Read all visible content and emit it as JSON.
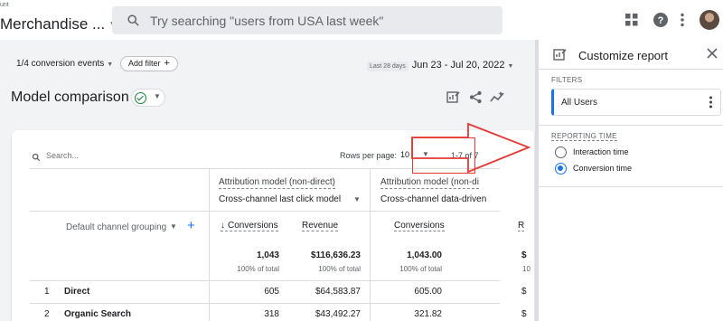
{
  "header": {
    "account_text": "unt",
    "property_name": "Merchandise ...",
    "search_placeholder": "Try searching \"users from USA last week\""
  },
  "toolbar": {
    "conversion_events": "1/4 conversion events",
    "add_filter": "Add filter",
    "date_badge": "Last 28 days",
    "date_range": "Jun 23 - Jul 20, 2022"
  },
  "report": {
    "title": "Model comparison"
  },
  "table": {
    "search_placeholder": "Search...",
    "rows_per_page_label": "Rows per page:",
    "rows_per_page_value": "10",
    "pager_text": "1-7 of 7",
    "dimension_label": "Default channel grouping",
    "models": [
      {
        "attribution_label": "Attribution model (non-direct)",
        "model": "Cross-channel last click model"
      },
      {
        "attribution_label": "Attribution model (non-di",
        "model": "Cross-channel data-driven"
      }
    ],
    "metric_headers": [
      "Conversions",
      "Revenue",
      "Conversions",
      "R"
    ],
    "totals": {
      "values": [
        "1,043",
        "$116,636.23",
        "1,043.00",
        "$"
      ],
      "percents": [
        "100% of total",
        "100% of total",
        "100% of total",
        "10"
      ]
    },
    "rows": [
      {
        "index": "1",
        "channel": "Direct",
        "values": [
          "605",
          "$64,583.87",
          "605.00",
          "$"
        ]
      },
      {
        "index": "2",
        "channel": "Organic Search",
        "values": [
          "318",
          "$43,492.27",
          "321.82",
          "$"
        ]
      }
    ]
  },
  "panel": {
    "title": "Customize report",
    "filters_label": "FILTERS",
    "filter_value": "All Users",
    "reporting_time_label": "REPORTING TIME",
    "options": [
      {
        "label": "Interaction time",
        "selected": false
      },
      {
        "label": "Conversion time",
        "selected": true
      }
    ]
  },
  "colors": {
    "accent": "#1a73e8",
    "annotation": "#e53935",
    "success": "#188038"
  }
}
